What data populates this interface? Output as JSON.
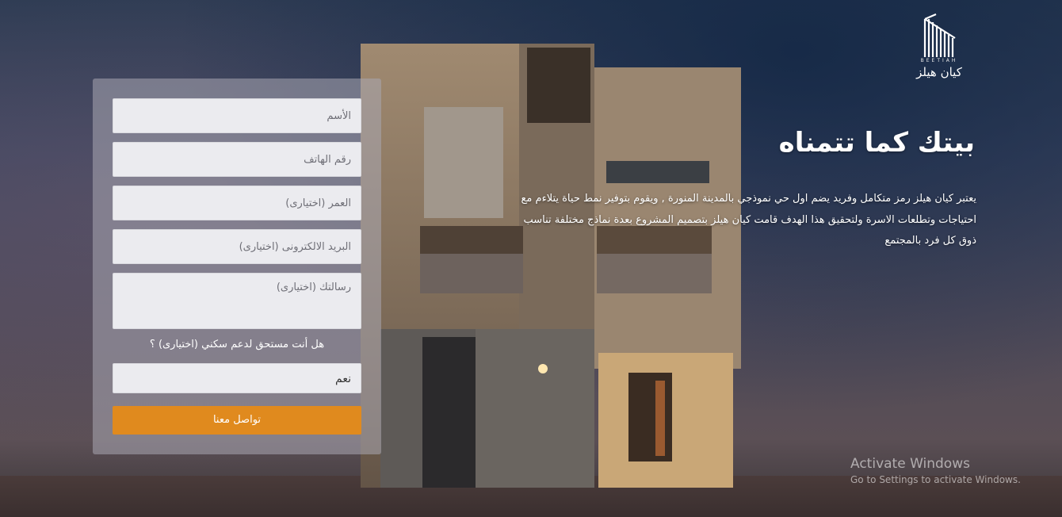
{
  "brand": {
    "logo_sub": "BEETIAH",
    "name": "كيان هيلز"
  },
  "hero": {
    "title": "بيتك كما تتمناه",
    "description": "يعتبر كيان هيلز رمز متكامل وفريد يضم اول حي نموذجي بالمدينة المنورة , ويقوم بتوفير نمط حياة يتلاءم مع احتياجات وتطلعات الاسرة ولتحقيق هذا الهدف قامت كيان هيلز بتصميم المشروع بعدة نماذج مختلفة تناسب ذوق كل فرد بالمجتمع"
  },
  "form": {
    "name_placeholder": "الأسم",
    "phone_placeholder": "رقم الهاتف",
    "age_placeholder": "العمر (اختيارى)",
    "email_placeholder": "البريد الالكترونى (اختيارى)",
    "message_placeholder": "رسالتك (اختيارى)",
    "support_question": "هل أنت مستحق لدعم سكني (اختيارى) ؟",
    "support_selected": "نعم",
    "submit_label": "تواصل معنا"
  },
  "watermark": {
    "title": "Activate Windows",
    "subtitle": "Go to Settings to activate Windows."
  },
  "colors": {
    "accent": "#e08a1e",
    "field_bg": "#ebebef",
    "card_bg": "rgba(170,168,178,0.55)"
  },
  "icons": {
    "logo": "building-stripes-logo"
  }
}
